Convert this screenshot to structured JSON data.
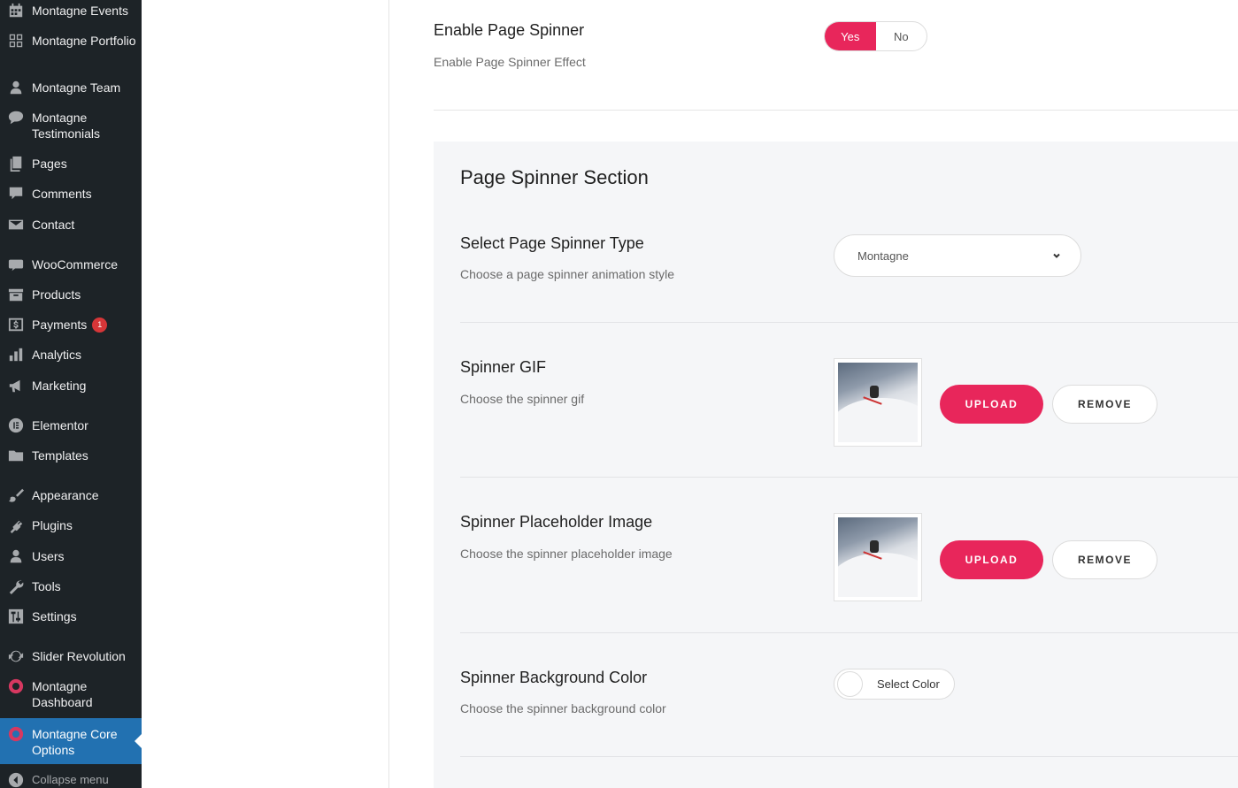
{
  "sidebar": {
    "items": [
      {
        "label": "Montagne Events",
        "icon": "calendar-icon"
      },
      {
        "label": "Montagne Portfolio",
        "icon": "grid-icon"
      },
      {
        "label": "Montagne Team",
        "icon": "user-icon"
      },
      {
        "label": "Montagne Testimonials",
        "icon": "speech-bubble-icon"
      },
      {
        "label": "Pages",
        "icon": "pages-icon"
      },
      {
        "label": "Comments",
        "icon": "comment-icon"
      },
      {
        "label": "Contact",
        "icon": "mail-icon"
      },
      {
        "label": "WooCommerce",
        "icon": "woo-icon"
      },
      {
        "label": "Products",
        "icon": "archive-icon"
      },
      {
        "label": "Payments",
        "icon": "dollar-icon",
        "badge": "1"
      },
      {
        "label": "Analytics",
        "icon": "bar-chart-icon"
      },
      {
        "label": "Marketing",
        "icon": "megaphone-icon"
      },
      {
        "label": "Elementor",
        "icon": "elementor-icon"
      },
      {
        "label": "Templates",
        "icon": "folder-icon"
      },
      {
        "label": "Appearance",
        "icon": "brush-icon"
      },
      {
        "label": "Plugins",
        "icon": "plug-icon"
      },
      {
        "label": "Users",
        "icon": "user-icon"
      },
      {
        "label": "Tools",
        "icon": "wrench-icon"
      },
      {
        "label": "Settings",
        "icon": "sliders-icon"
      },
      {
        "label": "Slider Revolution",
        "icon": "refresh-icon"
      },
      {
        "label": "Montagne Dashboard",
        "icon": "montagne-logo-icon"
      },
      {
        "label": "Montagne Core Options",
        "icon": "montagne-logo-icon",
        "active": true
      }
    ],
    "collapse_label": "Collapse menu"
  },
  "enable_spinner": {
    "title": "Enable Page Spinner",
    "description": "Enable Page Spinner Effect",
    "yes_label": "Yes",
    "no_label": "No",
    "value": "Yes"
  },
  "section": {
    "title": "Page Spinner Section",
    "spinner_type": {
      "title": "Select Page Spinner Type",
      "description": "Choose a page spinner animation style",
      "selected": "Montagne"
    },
    "spinner_gif": {
      "title": "Spinner GIF",
      "description": "Choose the spinner gif",
      "upload_label": "UPLOAD",
      "remove_label": "REMOVE"
    },
    "placeholder_image": {
      "title": "Spinner Placeholder Image",
      "description": "Choose the spinner placeholder image",
      "upload_label": "UPLOAD",
      "remove_label": "REMOVE"
    },
    "background_color": {
      "title": "Spinner Background Color",
      "description": "Choose the spinner background color",
      "button_label": "Select Color",
      "value": "#ffffff"
    }
  },
  "colors": {
    "accent": "#e8265b",
    "sidebar_bg": "#1d2327",
    "sidebar_active": "#2271b1",
    "badge": "#d63638"
  }
}
